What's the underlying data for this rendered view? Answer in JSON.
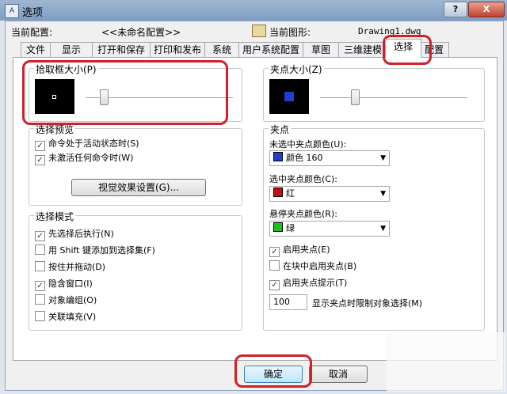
{
  "window": {
    "title": "选项",
    "app_icon": "autocad-icon",
    "help_label": "?",
    "close_label": "X"
  },
  "header": {
    "current_config_label": "当前配置:",
    "current_config_value": "<<未命名配置>>",
    "current_drawing_label": "当前图形:",
    "current_drawing_value": "Drawing1.dwg"
  },
  "tabs": [
    "文件",
    "显示",
    "打开和保存",
    "打印和发布",
    "系统",
    "用户系统配置",
    "草图",
    "三维建模",
    "选择",
    "配置"
  ],
  "active_tab": "选择",
  "pickbox": {
    "title": "拾取框大小(P)"
  },
  "grip_size": {
    "title": "夹点大小(Z)"
  },
  "selection_preview": {
    "title": "选择预览",
    "items": [
      {
        "label": "命令处于活动状态时(S)",
        "checked": true
      },
      {
        "label": "未激活任何命令时(W)",
        "checked": true
      }
    ],
    "button": "视觉效果设置(G)..."
  },
  "selection_modes": {
    "title": "选择模式",
    "items": [
      {
        "label": "先选择后执行(N)",
        "checked": true
      },
      {
        "label": "用 Shift 键添加到选择集(F)",
        "checked": false
      },
      {
        "label": "按住并拖动(D)",
        "checked": false
      },
      {
        "label": "隐含窗口(I)",
        "checked": true
      },
      {
        "label": "对象编组(O)",
        "checked": false
      },
      {
        "label": "关联填充(V)",
        "checked": false
      }
    ]
  },
  "grips": {
    "title": "夹点",
    "unselected_label": "未选中夹点颜色(U):",
    "unselected_value": "颜色 160",
    "unselected_color": "#1f3fd0",
    "selected_label": "选中夹点颜色(C):",
    "selected_value": "红",
    "selected_color": "#c01010",
    "hover_label": "悬停夹点颜色(R):",
    "hover_value": "绿",
    "hover_color": "#20c020",
    "items": [
      {
        "label": "启用夹点(E)",
        "checked": true
      },
      {
        "label": "在块中启用夹点(B)",
        "checked": false
      },
      {
        "label": "启用夹点提示(T)",
        "checked": true
      }
    ],
    "limit_value": "100",
    "limit_label": "显示夹点时限制对象选择(M)"
  },
  "footer": {
    "ok": "确定",
    "cancel": "取消"
  }
}
